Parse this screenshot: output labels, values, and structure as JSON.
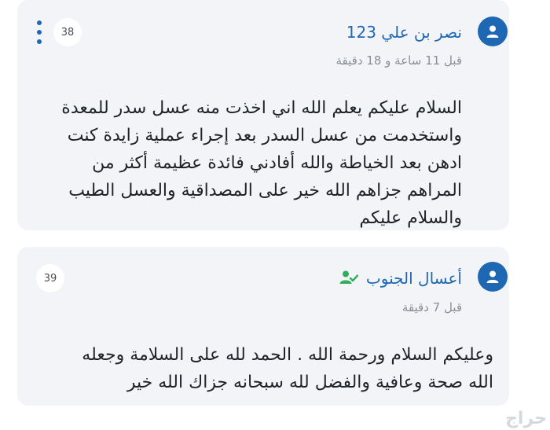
{
  "comments": [
    {
      "username": "نصر بن علي 123",
      "time_ago": "قبل 11 ساعة و 18 دقيقة",
      "number": "38",
      "text_lines": [
        "السلام عليكم يعلم الله اني اخذت منه عسل سدر للمعدة",
        "واستخدمت من عسل السدر بعد إجراء عملية زايدة كنت",
        "ادهن بعد الخياطة والله أفادني فائدة عظيمة أكثر من",
        "المراهم جزاهم الله خير على المصداقية والعسل الطيب",
        "والسلام عليكم"
      ]
    },
    {
      "username": "أعسال الجنوب",
      "time_ago": "قبل 7 دقيقة",
      "number": "39",
      "text_lines": [
        "وعليكم السلام ورحمة الله . الحمد لله على السلامة وجعله",
        "الله صحة وعافية والفضل لله سبحانه جزاك الله خير"
      ]
    }
  ],
  "watermark": "حراج",
  "colors": {
    "accent": "#1e67b3",
    "verified_green": "#2fae5c",
    "card_bg": "#f3f4f8",
    "muted_text": "#8a8f97"
  },
  "icons": {
    "avatar": "user-icon",
    "menu": "more-vertical-icon",
    "verified": "verified-user-icon"
  }
}
